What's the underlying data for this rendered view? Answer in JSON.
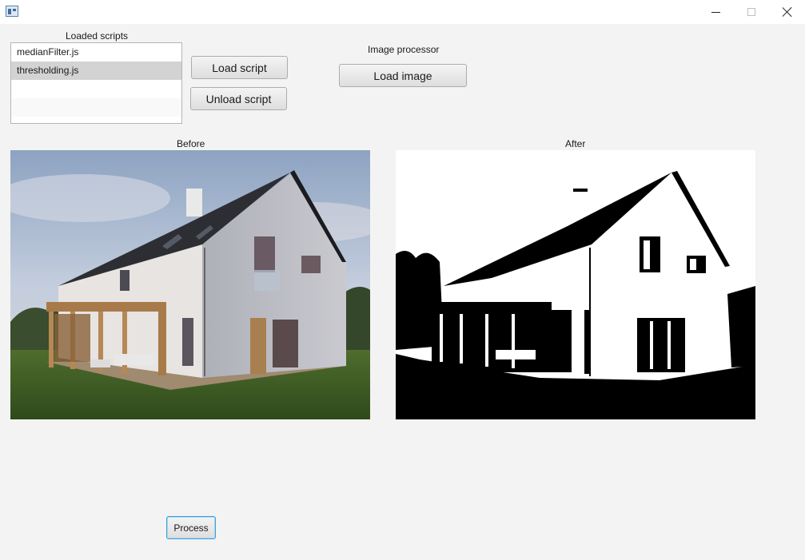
{
  "window": {
    "controls": {
      "minimize_icon": "minimize-icon",
      "maximize_icon": "maximize-icon",
      "close_icon": "close-icon"
    }
  },
  "scripts_panel": {
    "title": "Loaded scripts",
    "items": [
      {
        "label": "medianFilter.js",
        "selected": false
      },
      {
        "label": "thresholding.js",
        "selected": true
      }
    ]
  },
  "buttons": {
    "load_script": "Load script",
    "unload_script": "Unload script",
    "load_image": "Load image",
    "process": "Process"
  },
  "image_processor": {
    "title": "Image processor"
  },
  "before": {
    "label": "Before"
  },
  "after": {
    "label": "After"
  },
  "colors": {
    "background": "#f3f3f3",
    "selection": "#d3d3d3",
    "focus_border": "#3c9fd8"
  }
}
